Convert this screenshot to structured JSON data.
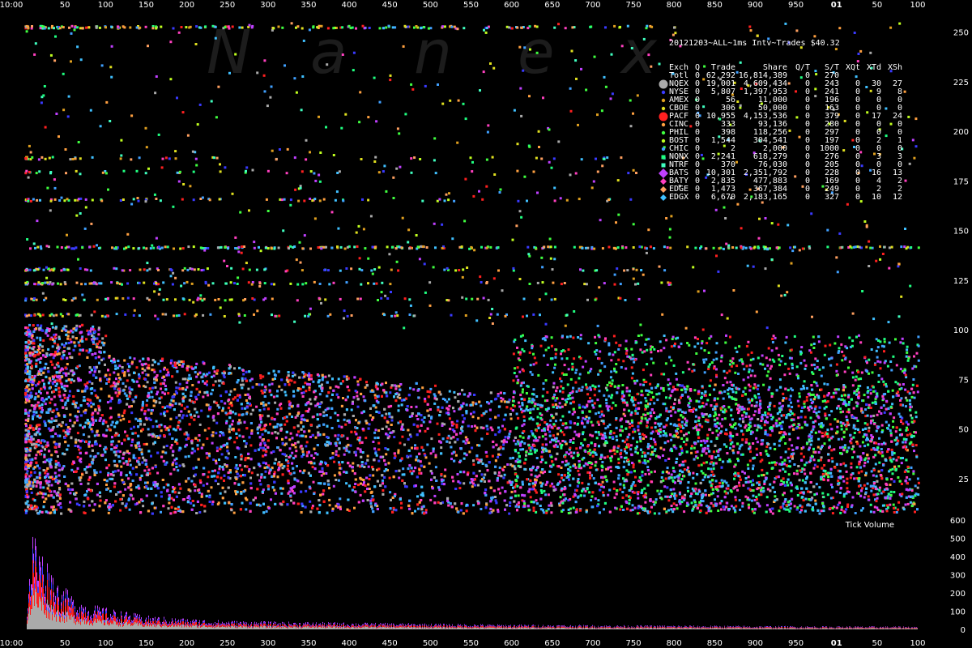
{
  "watermark": [
    "N",
    "a",
    "n",
    "e",
    "x"
  ],
  "chart_data": {
    "type": "scatter",
    "title": "20121203~ALL~1ms Intv~Trades $40.32",
    "x_axis": {
      "top_labels": [
        "10:00",
        "50",
        "100",
        "150",
        "200",
        "250",
        "300",
        "350",
        "400",
        "450",
        "500",
        "550",
        "600",
        "650",
        "700",
        "750",
        "800",
        "850",
        "900",
        "950",
        "01",
        "50",
        "100"
      ],
      "bottom_labels": [
        "10:00",
        "50",
        "100",
        "150",
        "200",
        "250",
        "300",
        "350",
        "400",
        "450",
        "500",
        "550",
        "600",
        "650",
        "700",
        "750",
        "800",
        "850",
        "900",
        "950",
        "01",
        "50",
        "100"
      ],
      "range": [
        0,
        1100
      ]
    },
    "y_axis_main": {
      "ticks": [
        25,
        50,
        75,
        100,
        125,
        150,
        175,
        200,
        225,
        250
      ],
      "range": [
        5,
        260
      ]
    },
    "y_axis_volume": {
      "label": "Tick Volume",
      "ticks": [
        0,
        100,
        200,
        300,
        400,
        500,
        600
      ],
      "range": [
        0,
        600
      ]
    },
    "grid": false,
    "legend_position": "top-right",
    "legend": {
      "headers": [
        "Exch",
        "Q",
        "Trade",
        "Share",
        "Q/T",
        "S/T",
        "XQt",
        "XTd",
        "XSh"
      ],
      "rows": [
        {
          "exch": "Totl",
          "q": "0",
          "trade": "62,292",
          "share": "16,814,389",
          "qt": "0",
          "st": "270",
          "xqt": "",
          "xtd": "",
          "xsh": "",
          "color": "#ffffff",
          "marker": "none"
        },
        {
          "exch": "NQEX",
          "q": "0",
          "trade": "19,001",
          "share": "4,609,434",
          "qt": "0",
          "st": "243",
          "xqt": "0",
          "xtd": "30",
          "xsh": "27",
          "color": "#aaaaaa",
          "marker": "big-circle"
        },
        {
          "exch": "NYSE",
          "q": "0",
          "trade": "5,807",
          "share": "1,397,953",
          "qt": "0",
          "st": "241",
          "xqt": "0",
          "xtd": "9",
          "xsh": "8",
          "color": "#3a3aff",
          "marker": "dot"
        },
        {
          "exch": "AMEX",
          "q": "0",
          "trade": "56",
          "share": "11,000",
          "qt": "0",
          "st": "196",
          "xqt": "0",
          "xtd": "0",
          "xsh": "0",
          "color": "#e0a020",
          "marker": "dot"
        },
        {
          "exch": "CBOE",
          "q": "0",
          "trade": "306",
          "share": "50,000",
          "qt": "0",
          "st": "163",
          "xqt": "0",
          "xtd": "0",
          "xsh": "0",
          "color": "#e0e020",
          "marker": "dot"
        },
        {
          "exch": "PACF",
          "q": "0",
          "trade": "10,955",
          "share": "4,153,536",
          "qt": "0",
          "st": "379",
          "xqt": "0",
          "xtd": "17",
          "xsh": "24",
          "color": "#ff2020",
          "marker": "big-circle"
        },
        {
          "exch": "CINC",
          "q": "0",
          "trade": "333",
          "share": "93,136",
          "qt": "0",
          "st": "280",
          "xqt": "0",
          "xtd": "0",
          "xsh": "0",
          "color": "#ffa040",
          "marker": "dot"
        },
        {
          "exch": "PHIL",
          "q": "0",
          "trade": "398",
          "share": "118,256",
          "qt": "0",
          "st": "297",
          "xqt": "0",
          "xtd": "0",
          "xsh": "0",
          "color": "#40ff40",
          "marker": "dot"
        },
        {
          "exch": "BOST",
          "q": "0",
          "trade": "1,544",
          "share": "304,541",
          "qt": "0",
          "st": "197",
          "xqt": "0",
          "xtd": "2",
          "xsh": "1",
          "color": "#c0ff20",
          "marker": "dot"
        },
        {
          "exch": "CHIC",
          "q": "0",
          "trade": "2",
          "share": "2,000",
          "qt": "0",
          "st": "1000",
          "xqt": "0",
          "xtd": "0",
          "xsh": "0",
          "color": "#40a0ff",
          "marker": "dot"
        },
        {
          "exch": "NQNX",
          "q": "0",
          "trade": "2,241",
          "share": "618,279",
          "qt": "0",
          "st": "276",
          "xqt": "0",
          "xtd": "3",
          "xsh": "3",
          "color": "#20ff80",
          "marker": "square"
        },
        {
          "exch": "NTRF",
          "q": "0",
          "trade": "370",
          "share": "76,030",
          "qt": "0",
          "st": "205",
          "xqt": "0",
          "xtd": "0",
          "xsh": "0",
          "color": "#40ffc0",
          "marker": "square"
        },
        {
          "exch": "BATS",
          "q": "0",
          "trade": "10,301",
          "share": "2,351,792",
          "qt": "0",
          "st": "228",
          "xqt": "0",
          "xtd": "16",
          "xsh": "13",
          "color": "#c040ff",
          "marker": "diamond"
        },
        {
          "exch": "BATY",
          "q": "0",
          "trade": "2,835",
          "share": "477,883",
          "qt": "0",
          "st": "169",
          "xqt": "0",
          "xtd": "4",
          "xsh": "2",
          "color": "#ff40c0",
          "marker": "diamond-small"
        },
        {
          "exch": "EDGE",
          "q": "0",
          "trade": "1,473",
          "share": "367,384",
          "qt": "0",
          "st": "249",
          "xqt": "0",
          "xtd": "2",
          "xsh": "2",
          "color": "#ffa060",
          "marker": "diamond-small"
        },
        {
          "exch": "EDGX",
          "q": "0",
          "trade": "6,670",
          "share": "2,183,165",
          "qt": "0",
          "st": "327",
          "xqt": "0",
          "xtd": "10",
          "xsh": "12",
          "color": "#40c0ff",
          "marker": "diamond-small"
        }
      ]
    },
    "price_bands": [
      {
        "price": 142,
        "density": 1.0
      },
      {
        "price": 253,
        "density": 0.7
      },
      {
        "price": 124,
        "density": 0.4
      },
      {
        "price": 131,
        "density": 0.35
      },
      {
        "price": 166,
        "density": 0.25
      },
      {
        "price": 187,
        "density": 0.2
      },
      {
        "price": 180,
        "density": 0.15
      },
      {
        "price": 116,
        "density": 0.3
      },
      {
        "price": 108,
        "density": 0.3
      }
    ],
    "volume_profile": {
      "x": [
        0,
        10,
        20,
        40,
        60,
        80,
        100,
        150,
        200,
        250,
        300,
        400,
        500,
        600,
        700,
        800,
        900,
        1000,
        1100
      ],
      "peak": [
        0,
        520,
        420,
        250,
        170,
        130,
        110,
        70,
        55,
        45,
        40,
        35,
        30,
        25,
        22,
        20,
        18,
        16,
        15
      ]
    }
  }
}
